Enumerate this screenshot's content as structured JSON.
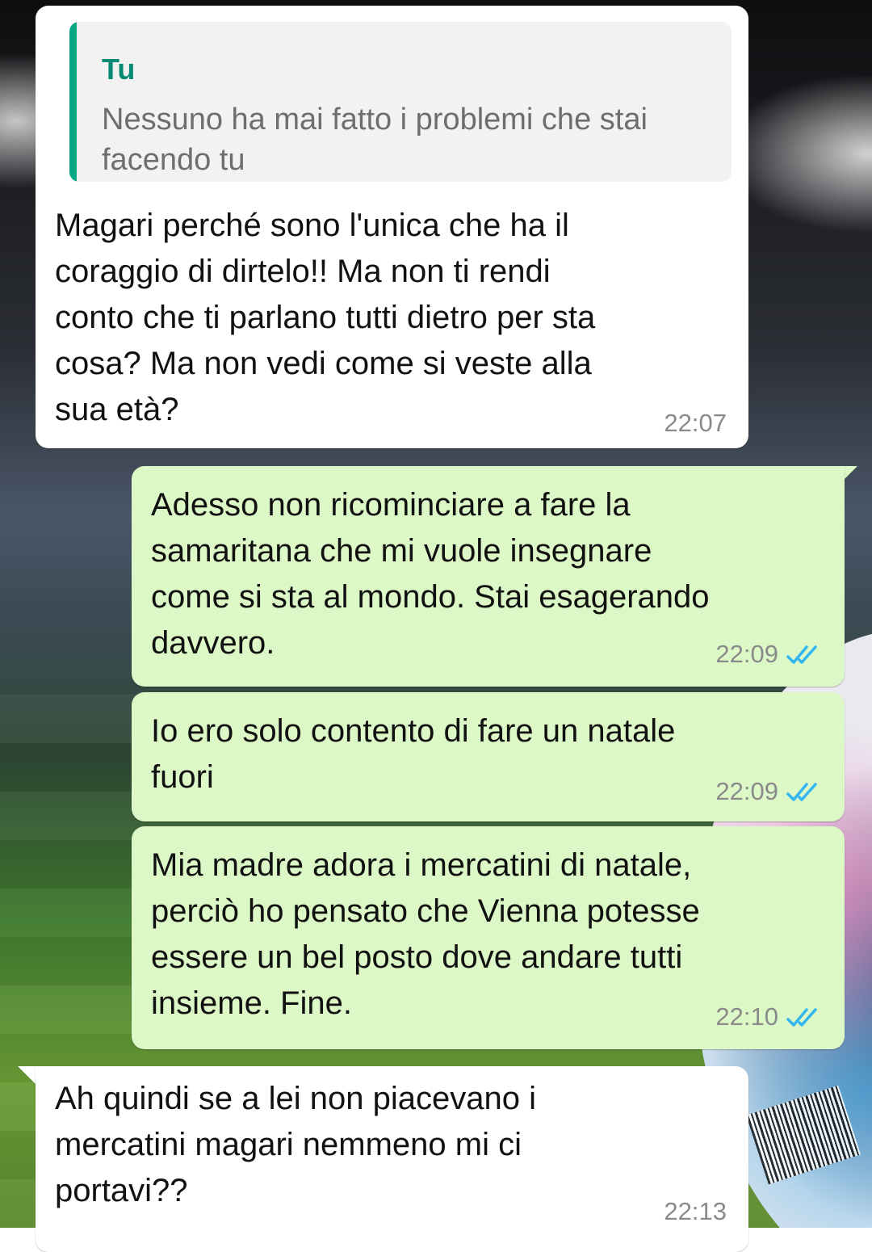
{
  "messages": [
    {
      "direction": "incoming",
      "quoted": {
        "author": "Tu",
        "text": "Nessuno ha mai fatto i\nproblemi che stai facendo tu"
      },
      "text": "Magari perché sono l'unica che ha il\ncoraggio di dirtelo!! Ma non ti rendi\nconto che ti parlano tutti dietro per sta\ncosa? Ma non vedi come si veste alla\nsua età?",
      "time": "22:07"
    },
    {
      "direction": "outgoing",
      "text": "Adesso non ricominciare a fare la\nsamaritana che mi vuole insegnare\ncome si sta al mondo. Stai esagerando\ndavvero.",
      "time": "22:09",
      "status": "read"
    },
    {
      "direction": "outgoing",
      "text": "Io ero solo contento di fare un natale\nfuori",
      "time": "22:09",
      "status": "read"
    },
    {
      "direction": "outgoing",
      "text": "Mia madre adora i mercatini di natale,\nperciò ho pensato che Vienna potesse\nessere un bel posto dove andare tutti\ninsieme. Fine.",
      "time": "22:10",
      "status": "read"
    },
    {
      "direction": "incoming",
      "text": "Ah quindi se a lei non piacevano i\nmercatini magari nemmeno mi ci\nportavi??",
      "time": "22:13"
    }
  ],
  "colors": {
    "incoming_bubble": "#ffffff",
    "outgoing_bubble": "#dcf8c6",
    "quote_accent": "#06a884",
    "read_ticks": "#34b7f1"
  }
}
